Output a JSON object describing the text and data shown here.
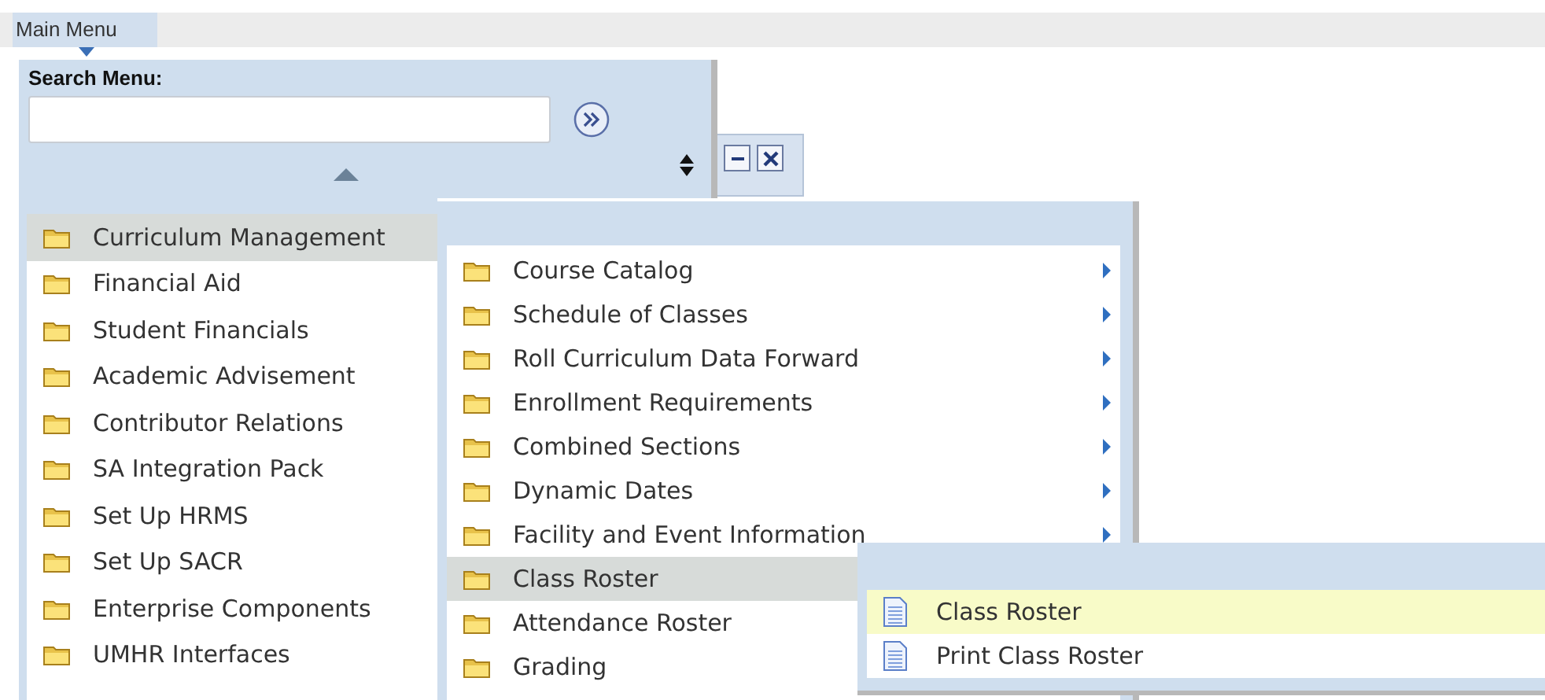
{
  "menu_bar": {
    "label": "Main Menu"
  },
  "search": {
    "label": "Search Menu:"
  },
  "menus": [
    {
      "items": [
        {
          "label": "Curriculum Management",
          "selected": true,
          "kind": "folder",
          "arrow": false
        },
        {
          "label": "Financial Aid",
          "selected": false,
          "kind": "folder",
          "arrow": false
        },
        {
          "label": "Student Financials",
          "selected": false,
          "kind": "folder",
          "arrow": false
        },
        {
          "label": "Academic Advisement",
          "selected": false,
          "kind": "folder",
          "arrow": false
        },
        {
          "label": "Contributor Relations",
          "selected": false,
          "kind": "folder",
          "arrow": false
        },
        {
          "label": "SA Integration Pack",
          "selected": false,
          "kind": "folder",
          "arrow": false
        },
        {
          "label": "Set Up HRMS",
          "selected": false,
          "kind": "folder",
          "arrow": false
        },
        {
          "label": "Set Up SACR",
          "selected": false,
          "kind": "folder",
          "arrow": false
        },
        {
          "label": "Enterprise Components",
          "selected": false,
          "kind": "folder",
          "arrow": false
        },
        {
          "label": "UMHR Interfaces",
          "selected": false,
          "kind": "folder",
          "arrow": false
        }
      ]
    },
    {
      "items": [
        {
          "label": "Course Catalog",
          "selected": false,
          "kind": "folder",
          "arrow": true
        },
        {
          "label": "Schedule of Classes",
          "selected": false,
          "kind": "folder",
          "arrow": true
        },
        {
          "label": "Roll Curriculum Data Forward",
          "selected": false,
          "kind": "folder",
          "arrow": true
        },
        {
          "label": "Enrollment Requirements",
          "selected": false,
          "kind": "folder",
          "arrow": true
        },
        {
          "label": "Combined Sections",
          "selected": false,
          "kind": "folder",
          "arrow": true
        },
        {
          "label": "Dynamic Dates",
          "selected": false,
          "kind": "folder",
          "arrow": true
        },
        {
          "label": "Facility and Event Information",
          "selected": false,
          "kind": "folder",
          "arrow": true
        },
        {
          "label": "Class Roster",
          "selected": true,
          "kind": "folder",
          "arrow": false
        },
        {
          "label": "Attendance Roster",
          "selected": false,
          "kind": "folder",
          "arrow": false
        },
        {
          "label": "Grading",
          "selected": false,
          "kind": "folder",
          "arrow": false
        }
      ]
    },
    {
      "items": [
        {
          "label": "Class Roster",
          "selected": true,
          "kind": "page",
          "arrow": false
        },
        {
          "label": "Print Class Roster",
          "selected": false,
          "kind": "page",
          "arrow": false
        }
      ]
    }
  ]
}
